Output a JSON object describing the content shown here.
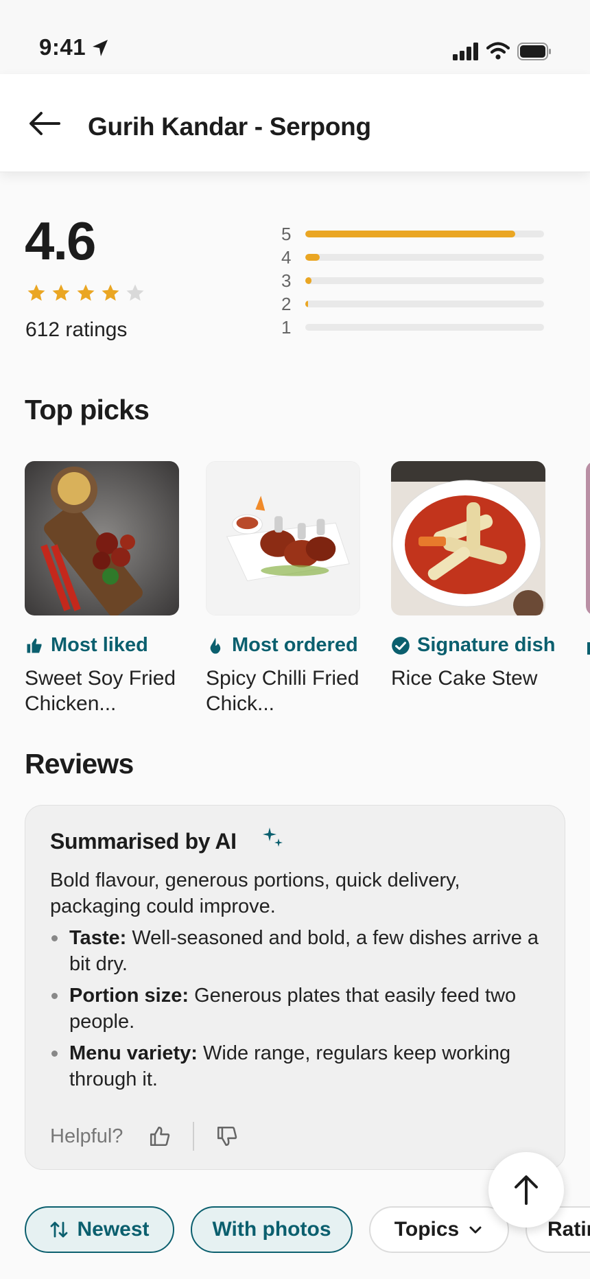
{
  "status_bar": {
    "time": "9:41"
  },
  "header": {
    "title": "Gurih Kandar - Serpong"
  },
  "rating": {
    "value": "4.6",
    "stars": 4,
    "ratings_count": "612 ratings",
    "distribution": [
      {
        "label": "5",
        "fraction": 0.88
      },
      {
        "label": "4",
        "fraction": 0.06
      },
      {
        "label": "3",
        "fraction": 0.025
      },
      {
        "label": "2",
        "fraction": 0.012
      },
      {
        "label": "1",
        "fraction": 0.0
      }
    ]
  },
  "top_picks": {
    "title": "Top picks",
    "items": [
      {
        "badge": "Most liked",
        "badge_icon": "thumbs-up-icon",
        "name": "Sweet Soy Fried Chicken..."
      },
      {
        "badge": "Most ordered",
        "badge_icon": "flame-icon",
        "name": "Spicy Chilli Fried Chick..."
      },
      {
        "badge": "Signature dish",
        "badge_icon": "check-badge-icon",
        "name": "Rice Cake Stew"
      }
    ]
  },
  "reviews": {
    "title": "Reviews",
    "ai_summary": {
      "title": "Summarised by AI",
      "summary": "Bold flavour, generous portions, quick delivery, packaging could improve.",
      "bullets": [
        {
          "label": "Taste:",
          "text": "Well-seasoned and bold, a few dishes arrive a bit dry."
        },
        {
          "label": "Portion size:",
          "text": "Generous plates that easily feed two people."
        },
        {
          "label": "Menu variety:",
          "text": "Wide range, regulars keep working through it."
        }
      ],
      "helpful_label": "Helpful?"
    }
  },
  "filters": {
    "newest": "Newest",
    "with_photos": "With photos",
    "topics": "Topics",
    "ratings": "Ratings"
  },
  "colors": {
    "accent": "#0b5f6e",
    "star": "#eaa623",
    "bar_fill": "#eaa623"
  }
}
